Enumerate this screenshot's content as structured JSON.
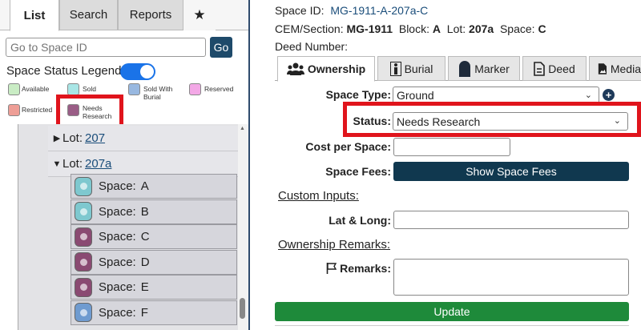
{
  "tabs": {
    "list": "List",
    "search": "Search",
    "reports": "Reports",
    "star": "★"
  },
  "goto": {
    "placeholder": "Go to Space ID",
    "button": "Go"
  },
  "legend": {
    "title": "Space Status Legend:",
    "items": [
      {
        "label": "Available",
        "color": "#c9ecc4"
      },
      {
        "label": "Sold",
        "color": "#a9e6e6"
      },
      {
        "label": "Sold With Burial",
        "color": "#98b8e0"
      },
      {
        "label": "Reserved",
        "color": "#f3a8e6"
      },
      {
        "label": "Restricted",
        "color": "#ee9e96"
      },
      {
        "label": "Needs Research",
        "color": "#9a5d86"
      }
    ]
  },
  "tree": {
    "lots": [
      {
        "prefix": "Lot:",
        "name": "207"
      },
      {
        "prefix": "Lot:",
        "name": "207a"
      }
    ],
    "spaces": [
      {
        "label": "Space:",
        "name": "A",
        "color": "#7ec8cf"
      },
      {
        "label": "Space:",
        "name": "B",
        "color": "#7ec8cf"
      },
      {
        "label": "Space:",
        "name": "C",
        "color": "#8a4a72"
      },
      {
        "label": "Space:",
        "name": "D",
        "color": "#8a4a72"
      },
      {
        "label": "Space:",
        "name": "E",
        "color": "#8a4a72"
      },
      {
        "label": "Space:",
        "name": "F",
        "color": "#6f9bd0"
      }
    ]
  },
  "details": {
    "space_id_label": "Space ID:",
    "space_id": "MG-1911-A-207a-C",
    "cem_label": "CEM/Section:",
    "cem": "MG-1911",
    "block_label": "Block:",
    "block": "A",
    "lot_label": "Lot:",
    "lot": "207a",
    "space_label": "Space:",
    "space": "C",
    "deed_label": "Deed Number:"
  },
  "rtabs": {
    "ownership": "Ownership",
    "burial": "Burial",
    "marker": "Marker",
    "deed": "Deed",
    "media": "Media"
  },
  "form": {
    "space_type_label": "Space Type:",
    "space_type": "Ground",
    "status_label": "Status:",
    "status": "Needs Research",
    "cost_label": "Cost per Space:",
    "fees_label": "Space Fees:",
    "fees_button": "Show Space Fees",
    "custom_inputs": "Custom Inputs:",
    "latlong_label": "Lat & Long:",
    "remarks_heading": "Ownership Remarks:",
    "remarks_label": "Remarks:",
    "update_button": "Update"
  }
}
